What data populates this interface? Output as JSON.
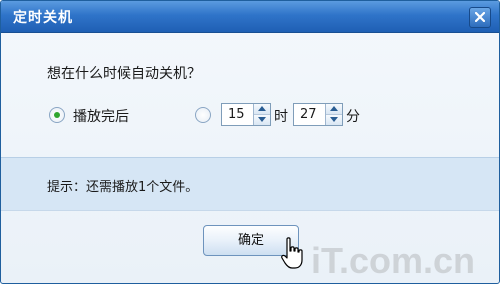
{
  "dialog": {
    "title": "定时关机",
    "close_icon": "close-icon"
  },
  "question": "想在什么时候自动关机？",
  "options": {
    "after_playback": {
      "label": "播放完后",
      "selected": true
    },
    "at_time": {
      "selected": false,
      "hour": "15",
      "hour_unit": "时",
      "minute": "27",
      "minute_unit": "分"
    }
  },
  "tip": "提示：还需播放1个文件。",
  "ok_button": "确定",
  "watermark": "iT.com.cn",
  "colors": {
    "titlebar": "#2f74c9",
    "tipbar": "#d6e6f5",
    "radio_dot": "#2fa52f"
  }
}
